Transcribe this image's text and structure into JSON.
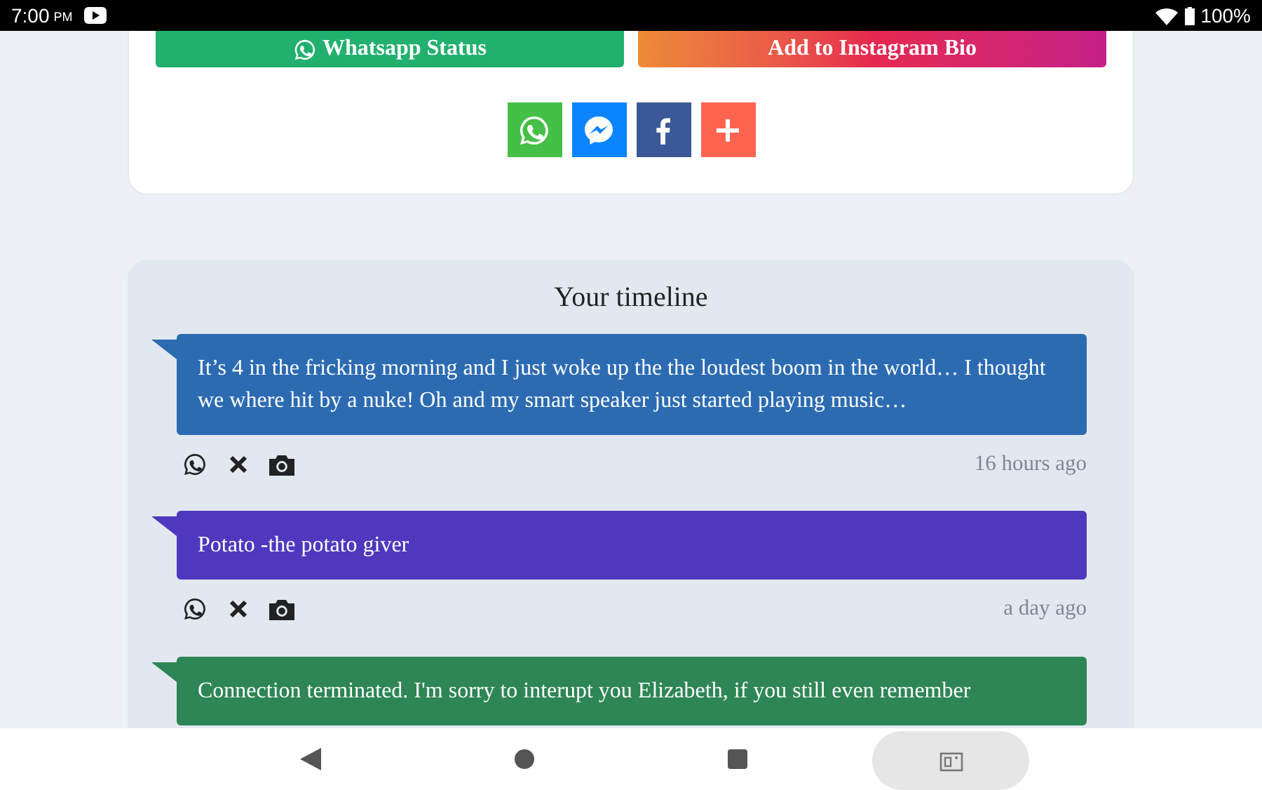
{
  "status_bar": {
    "time": "7:00",
    "meridiem": "PM",
    "battery": "100%"
  },
  "share_card": {
    "buttons": [
      {
        "kind": "whatsapp",
        "label": "Whatsapp Status"
      },
      {
        "kind": "instagram",
        "label": "Add to Instagram Bio"
      }
    ],
    "share_icons": [
      {
        "kind": "whatsapp"
      },
      {
        "kind": "messenger"
      },
      {
        "kind": "facebook"
      },
      {
        "kind": "more"
      }
    ]
  },
  "timeline": {
    "title": "Your timeline",
    "posts": [
      {
        "text": "It’s 4 in the fricking morning and I just woke up the the loudest boom in the world… I thought we where hit by a nuke! Oh and my smart speaker just started playing music…",
        "color": "#2c6bb2",
        "time": "16 hours ago"
      },
      {
        "text": "Potato -the potato giver",
        "color": "#4f38bd",
        "time": "a day ago"
      },
      {
        "text": "Connection terminated. I'm sorry to interupt you Elizabeth, if you still even remember",
        "color": "#2e8555"
      }
    ]
  }
}
